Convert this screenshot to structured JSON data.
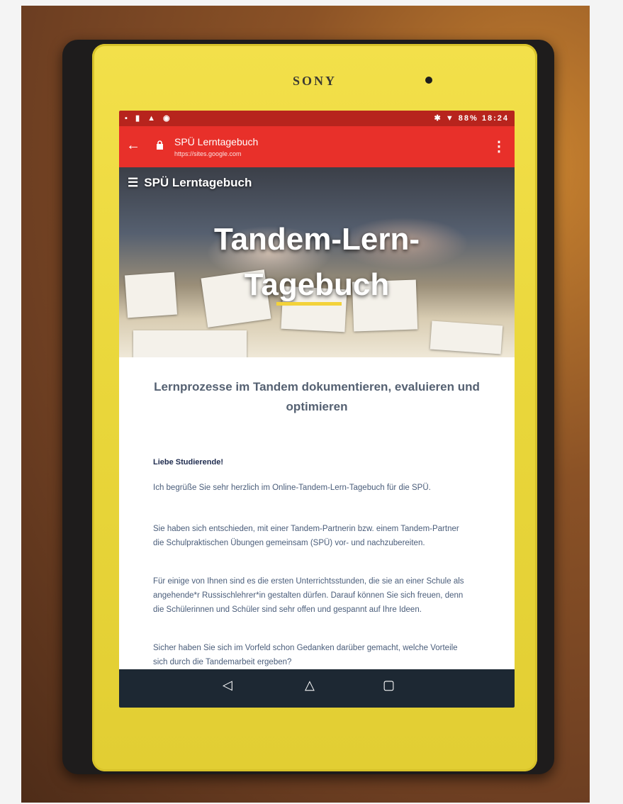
{
  "device": {
    "brand": "SONY"
  },
  "status_bar": {
    "left_icons": "▪ ▮ ▲ ◉",
    "time": "18:24",
    "battery": "88%"
  },
  "browser": {
    "page_title": "SPÜ Lerntagebuch",
    "host": "https://sites.google.com",
    "back_icon": "←",
    "menu_icon": "⋮"
  },
  "site": {
    "nav_title": "SPÜ Lerntagebuch",
    "hero_title_line1": "Tandem-Lern-",
    "hero_title_line2": "Tagebuch",
    "subtitle": "Lernprozesse im Tandem dokumentieren, evaluieren und optimieren",
    "greeting": "Liebe Studierende!",
    "paragraphs": [
      "Ich begrüße Sie sehr herzlich im Online-Tandem-Lern-Tagebuch für die SPÜ.",
      "Sie haben sich entschieden, mit einer Tandem-Partnerin bzw. einem Tandem-Partner die Schulpraktischen Übungen gemeinsam (SPÜ) vor- und nachzubereiten.",
      "Für einige von Ihnen sind es die ersten Unterrichtsstunden, die sie an einer Schule als angehende*r Russischlehrer*in gestalten dürfen. Darauf können Sie sich freuen, denn die Schülerinnen und Schüler sind sehr offen und gespannt auf Ihre Ideen.",
      "Sicher haben Sie sich im Vorfeld schon Gedanken darüber gemacht, welche Vorteile sich durch die Tandemarbeit ergeben?"
    ]
  },
  "nav_bar": {
    "back": "◁",
    "home": "△",
    "recents": "▢"
  },
  "colors": {
    "url_bar": "#e8302a",
    "status_bar": "#b7241d",
    "tablet_body": "#e9d63a",
    "nav_bar": "#1d2833"
  }
}
